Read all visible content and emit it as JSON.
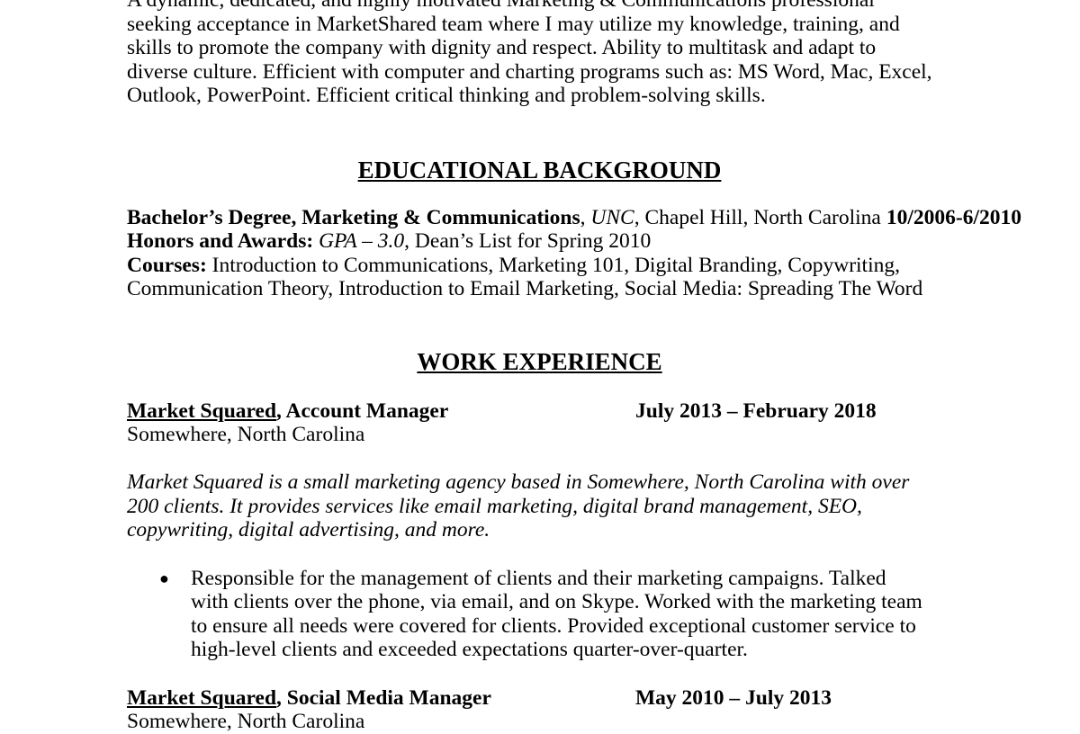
{
  "summary": "A dynamic, dedicated, and highly motivated Marketing & Communications professional seeking acceptance in MarketShared team where I may utilize my knowledge, training, and skills to promote the company with dignity and respect. Ability to multitask and adapt to diverse culture. Efficient with computer and charting programs such as: MS Word, Mac, Excel, Outlook, PowerPoint. Efficient critical thinking and problem-solving skills.",
  "education": {
    "heading": "EDUCATIONAL BACKGROUND",
    "degree": "Bachelor’s Degree, Marketing & Communications",
    "school": "UNC",
    "location": ", Chapel Hill, North Carolina",
    "dates": "10/2006-6/2010",
    "honors_label": "Honors and Awards:",
    "gpa": "GPA – 3.0",
    "honors_rest": ", Dean’s List for Spring 2010",
    "courses_label": "Courses:",
    "courses_line1": "Introduction to Communications, Marketing 101, Digital Branding, Copywriting,",
    "courses_line2": "Communication Theory, Introduction to Email Marketing, Social Media: Spreading The Word"
  },
  "work": {
    "heading": "WORK EXPERIENCE",
    "jobs": [
      {
        "company": "Market Squared",
        "title": ", Account Manager",
        "dates": "July 2013 – February 2018",
        "location": "Somewhere, North Carolina",
        "description": "Market Squared is a small marketing agency based in Somewhere, North Carolina with over 200 clients. It provides services like email marketing, digital brand management, SEO, copywriting, digital advertising, and more.",
        "bullet_symbol": "●",
        "bullets": [
          "Responsible for the management of clients and their marketing campaigns. Talked with clients over the phone, via email, and on Skype. Worked with the marketing team to ensure all needs were covered for clients. Provided exceptional customer service to high-level clients and exceeded expectations quarter-over-quarter."
        ]
      },
      {
        "company": "Market Squared",
        "title": ", Social Media Manager",
        "dates": "May 2010 – July 2013",
        "location": "Somewhere, North Carolina"
      }
    ]
  }
}
